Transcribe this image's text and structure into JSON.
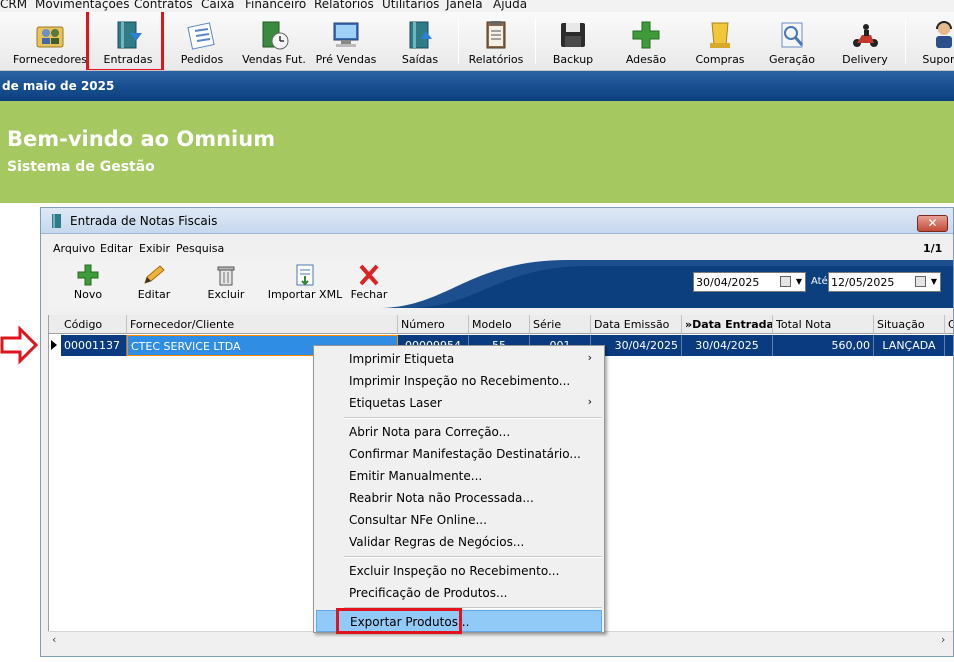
{
  "menubar": [
    "CRM",
    "Movimentações",
    "Contratos",
    "Caixa",
    "Financeiro",
    "Relatórios",
    "Utilitários",
    "Janela",
    "Ajuda"
  ],
  "toolbar": [
    {
      "label": "Fornecedores",
      "icon": "suppliers-icon"
    },
    {
      "label": "Entradas",
      "icon": "entries-icon"
    },
    {
      "label": "Pedidos",
      "icon": "orders-icon"
    },
    {
      "label": "Vendas Fut.",
      "icon": "future-sales-icon"
    },
    {
      "label": "Pré Vendas",
      "icon": "pre-sales-icon"
    },
    {
      "label": "Saídas",
      "icon": "outputs-icon"
    },
    {
      "label": "Relatórios",
      "icon": "reports-icon"
    },
    {
      "label": "Backup",
      "icon": "backup-icon"
    },
    {
      "label": "Adesão",
      "icon": "adhesion-icon"
    },
    {
      "label": "Compras",
      "icon": "purchases-icon"
    },
    {
      "label": "Geração",
      "icon": "generation-icon"
    },
    {
      "label": "Delivery",
      "icon": "delivery-icon"
    },
    {
      "label": "Suporte",
      "icon": "support-icon"
    }
  ],
  "date_band": "de maio de 2025",
  "welcome": {
    "title": "Bem-vindo ao Omnium",
    "subtitle": "Sistema de Gestão"
  },
  "dialog": {
    "title": "Entrada de Notas Fiscais",
    "close": "✕",
    "menu": [
      "Arquivo",
      "Editar",
      "Exibir",
      "Pesquisa"
    ],
    "page": "1/1",
    "toolbar": [
      {
        "label": "Novo",
        "icon": "add-icon"
      },
      {
        "label": "Editar",
        "icon": "edit-pencil-icon"
      },
      {
        "label": "Excluir",
        "icon": "trash-icon"
      },
      {
        "label": "Importar XML",
        "icon": "import-xml-icon"
      },
      {
        "label": "Fechar",
        "icon": "close-x-icon"
      }
    ],
    "date_from": "30/04/2025",
    "date_sep": "Até",
    "date_to": "12/05/2025",
    "columns": [
      "Código",
      "Fornecedor/Cliente",
      "Número",
      "Modelo",
      "Série",
      "Data Emissão",
      "»Data Entrada",
      "Total Nota",
      "Situação",
      "C"
    ],
    "row": {
      "codigo": "00001137",
      "fornecedor": "CTEC SERVICE LTDA",
      "numero": "00009954",
      "modelo": "55",
      "serie": "001",
      "emissao": "30/04/2025",
      "entrada": "30/04/2025",
      "total": "560,00",
      "situacao": "LANÇADA"
    },
    "scroll_left": "‹",
    "scroll_right": "›"
  },
  "context_menu": [
    {
      "label": "Imprimir Etiqueta",
      "submenu": true
    },
    {
      "label": "Imprimir Inspeção no Recebimento..."
    },
    {
      "label": "Etiquetas Laser",
      "submenu": true
    },
    {
      "label": "Abrir Nota para Correção..."
    },
    {
      "label": "Confirmar Manifestação Destinatário..."
    },
    {
      "label": "Emitir Manualmente..."
    },
    {
      "label": "Reabrir Nota não Processada..."
    },
    {
      "label": "Consultar NFe Online..."
    },
    {
      "label": "Validar Regras de Negócios..."
    },
    {
      "label": "Excluir Inspeção no Recebimento..."
    },
    {
      "label": "Precificação de Produtos..."
    },
    {
      "label": "Exportar Produtos..."
    }
  ],
  "submenu_glyph": "›",
  "colors": {
    "accent_red": "#e1141e",
    "welcome_green": "#a6c861",
    "band_blue": "#0b3f7e",
    "row_selected": "#0a3a80",
    "menu_highlight": "#91c9f7"
  }
}
